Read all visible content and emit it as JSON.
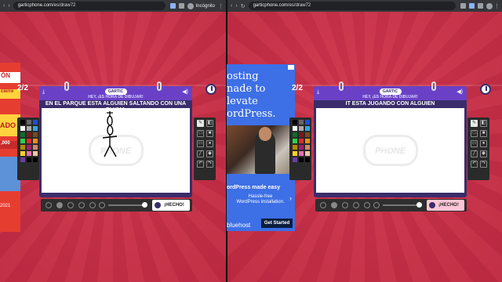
{
  "browser": {
    "left": {
      "host": "garticphone.com",
      "path": "/es/draw72",
      "profile_label": "Incógnito"
    },
    "right": {
      "host": "garticphone.com",
      "path": "/es/draw72"
    }
  },
  "ads": {
    "left": {
      "line1": "ÓN",
      "line2": "cierre",
      "line3": "ADO",
      "line4": ",000",
      "line5": "2021"
    },
    "right": {
      "headline_1": "osting",
      "headline_2": "nade to",
      "headline_3": "levate",
      "headline_4": "ordPress.",
      "subtitle": "ordPress made easy",
      "body_1": "Hassle-free",
      "body_2": "WordPress installation.",
      "brand": "bluehost",
      "cta": "Get Started"
    }
  },
  "game": {
    "logo": "GARTIC",
    "watermark": "PHONE",
    "left": {
      "counter": "2/2",
      "hey": "HEY, ¡ES HORA DE DIBUJAR!",
      "prompt": "EN EL PARQUE ESTA ALGUIEN SALTANDO CON UNA PLUMA",
      "done_label": "¡HECHO!",
      "drawing_present": true
    },
    "right": {
      "counter": "2/2",
      "hey": "HEY, ¡ES HORA DE DIBUJAR!",
      "prompt": "IT ESTA JUGANDO CON ALGUIEN",
      "done_label": "¡HECHO!",
      "drawing_present": false
    },
    "palette_colors": [
      "#000000",
      "#666666",
      "#1f4fd1",
      "#ffffff",
      "#aaaaaa",
      "#2fa6e8",
      "#0b6e2c",
      "#7a1b1b",
      "#7a4a1e",
      "#2ed14a",
      "#e02b2b",
      "#ff8a1f",
      "#b38a00",
      "#a01f6e",
      "#c98b6a",
      "#ffd21f",
      "#e56fb0",
      "#ffc1a4",
      "#6b3fa0",
      "#000000",
      "#000000"
    ],
    "tools": [
      "pencil",
      "eraser",
      "square",
      "square-fill",
      "rect",
      "circle",
      "line",
      "fill",
      "undo",
      "redo"
    ],
    "tool_icons": {
      "pencil": "✎",
      "eraser": "◧",
      "square": "□",
      "square-fill": "■",
      "rect": "▭",
      "circle": "●",
      "line": "╱",
      "fill": "◆",
      "undo": "↶",
      "redo": "↷"
    }
  }
}
